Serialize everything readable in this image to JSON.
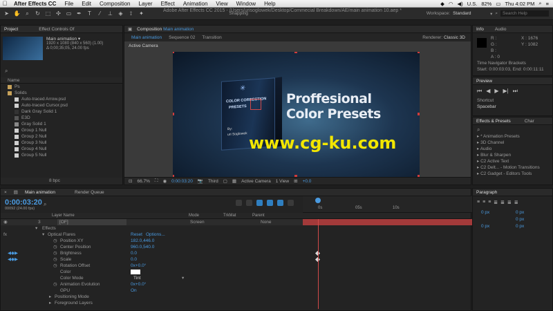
{
  "menubar": {
    "app": "After Effects CC",
    "items": [
      "File",
      "Edit",
      "Composition",
      "Layer",
      "Effect",
      "Animation",
      "View",
      "Window",
      "Help"
    ],
    "status": {
      "input": "U.S.",
      "battery": "82%",
      "time": "Thu 4:02 PM"
    }
  },
  "window_title": "Adobe After Effects CC 2015 - /Users/urisoglowek/Desktop/Commecial Breakdown/AE/main animation 10.aep *",
  "toolbar": {
    "snapping": "Snapping",
    "workspace_label": "Workspace:",
    "workspace_value": "Standard",
    "search_placeholder": "Search Help"
  },
  "project": {
    "tab": "Project",
    "tab2": "Effect Controls Of",
    "comp_name": "Main animation ▾",
    "comp_info1": "1920 x 1080  (840 x 560) (1.00)",
    "comp_info2": "Δ 0;00;35;05, 24.00 fps",
    "col_name": "Name",
    "items": [
      "Ps",
      "Solids",
      "Auto-traced Arrow.psd",
      "Auto-traced Cursor.psd",
      "Dark Gray Solid 1",
      "E3D",
      "Gray Solid 1",
      "Group 1 Null",
      "Group 2 Null",
      "Group 3 Null",
      "Group 4 Null",
      "Group 5 Null"
    ],
    "bpc": "8 bpc"
  },
  "composition": {
    "tab": "Composition",
    "tab_name": "Main animation",
    "sub_tabs": [
      "Main animation",
      "Sequence 02",
      "Transition"
    ],
    "renderer_label": "Renderer:",
    "renderer": "Classic 3D",
    "camera_label": "Active Camera",
    "box_title": "COLOR CORRECTION",
    "box_sub": "PRESETS",
    "box_by": "By:",
    "box_author": "uri Soglowek",
    "headline1": "Proffesional",
    "headline2": "Color Presets",
    "watermark": "www.cg-ku.com",
    "footer": {
      "zoom": "66.7%",
      "time": "0:00:03:20",
      "res": "Third",
      "camera": "Active Camera",
      "view": "1 View",
      "exposure": "+0.0"
    }
  },
  "info": {
    "tab": "Info",
    "tab2": "Audio",
    "x": "X : 1676",
    "y": "Y : 1082",
    "channels": [
      "R :",
      "G :",
      "B :",
      "A : 0"
    ],
    "tn_title": "Time Navigator Brackets",
    "tn_range": "Start: 0:00:03:03, End: 0:00:11:11"
  },
  "preview": {
    "tab": "Preview",
    "shortcut_label": "Shortcut",
    "shortcut_value": "Spacebar"
  },
  "effects": {
    "tab": "Effects & Presets",
    "tab2": "Char",
    "items": [
      "* Animation Presets",
      "3D Channel",
      "Audio",
      "Blur & Sharpen",
      "C2 Active Text",
      "C2 Delt... - Motion Transitions",
      "C2 Gadget - Editors Tools"
    ]
  },
  "paragraph": {
    "tab": "Paragraph",
    "values": [
      "0 px",
      "0 px",
      "0 px",
      "0 px",
      "0 px"
    ]
  },
  "timeline": {
    "tab": "Main animation",
    "tab2": "Render Queue",
    "timecode": "0:00:03:20",
    "frames": "00092 (24.00 fps)",
    "col_layer": "Layer Name",
    "col_mode": "Mode",
    "col_trkmat": "TrkMat",
    "col_parent": "Parent",
    "layer_num": "3",
    "layer_name": "[OF]",
    "layer_mode": "Screen",
    "layer_parent": "None",
    "effects_label": "Effects",
    "effect_name": "Optical Flares",
    "reset": "Reset",
    "options": "Options...",
    "props": [
      {
        "name": "Position XY",
        "value": "182.0,446.0"
      },
      {
        "name": "Center Position",
        "value": "960.0,540.0"
      },
      {
        "name": "Brightness",
        "value": "0.0"
      },
      {
        "name": "Scale",
        "value": "0.0"
      },
      {
        "name": "Rotation Offset",
        "value": "0x+0.0°"
      },
      {
        "name": "Color",
        "value": ""
      },
      {
        "name": "Color Mode",
        "value": "Tint"
      },
      {
        "name": "Animation Evolution",
        "value": "0x+0.0°"
      },
      {
        "name": "GPU",
        "value": "On"
      },
      {
        "name": "Positioning Mode",
        "value": ""
      },
      {
        "name": "Foreground Layers",
        "value": ""
      }
    ],
    "ruler": [
      "0s",
      "05s",
      "10s"
    ]
  },
  "colors": {
    "accent": "#4a9ae0",
    "handle": "#d23b3b",
    "watermark": "#f2e600",
    "layer_bar": "#a33a3a"
  }
}
